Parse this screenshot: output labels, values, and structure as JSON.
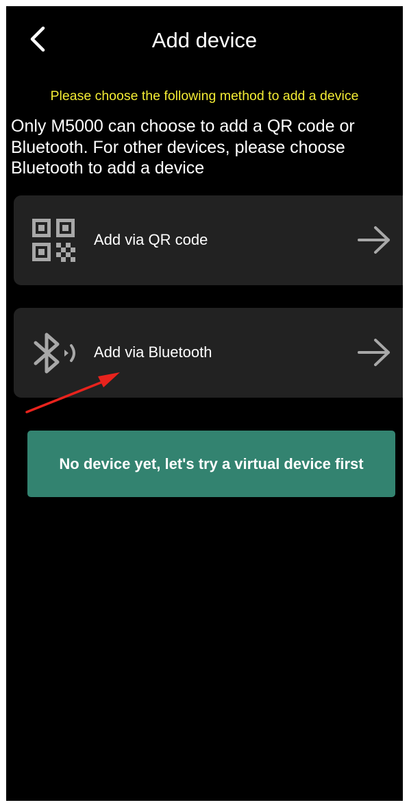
{
  "header": {
    "title": "Add device",
    "back_icon": "chevron-left-icon"
  },
  "hint": "Please choose the following method to add a device",
  "description": "Only M5000 can choose to add a QR code or Bluetooth. For other devices, please choose Bluetooth to add a device",
  "options": [
    {
      "label": "Add via QR code",
      "icon": "qr-code-icon",
      "trailing_icon": "arrow-right-icon"
    },
    {
      "label": "Add via Bluetooth",
      "icon": "bluetooth-icon",
      "trailing_icon": "arrow-right-icon"
    }
  ],
  "virtual_device_button": "No device yet, let's try a virtual device first",
  "colors": {
    "background": "#000000",
    "card": "#222222",
    "hint": "#f3ec34",
    "accent": "#338370",
    "icon": "#a8a8a8",
    "annotation": "#e8231d"
  }
}
